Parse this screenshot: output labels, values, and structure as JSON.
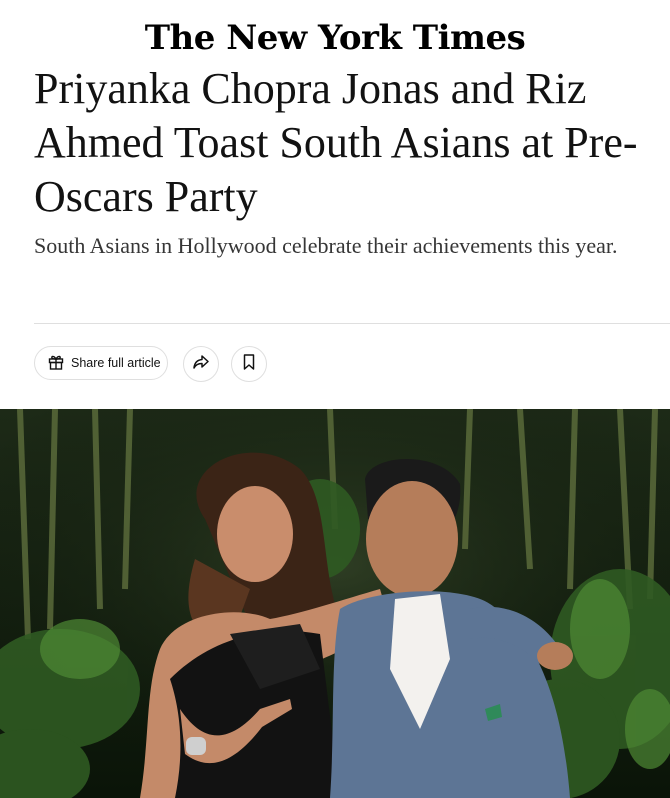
{
  "masthead": {
    "logo_text": "The New York Times"
  },
  "article": {
    "headline": "Priyanka Chopra Jonas and Riz Ahmed Toast South Asians at Pre-Oscars Party",
    "summary": "South Asians in Hollywood celebrate their achievements this year."
  },
  "toolbar": {
    "share_label": "Share full article",
    "icons": [
      "gift-icon",
      "share-arrow-icon",
      "bookmark-icon"
    ]
  },
  "photo": {
    "subject": "photo of two people posing at a party in front of greenery"
  },
  "colors": {
    "text": "#121212",
    "summary": "#363636",
    "divider": "#dfdfdf"
  }
}
